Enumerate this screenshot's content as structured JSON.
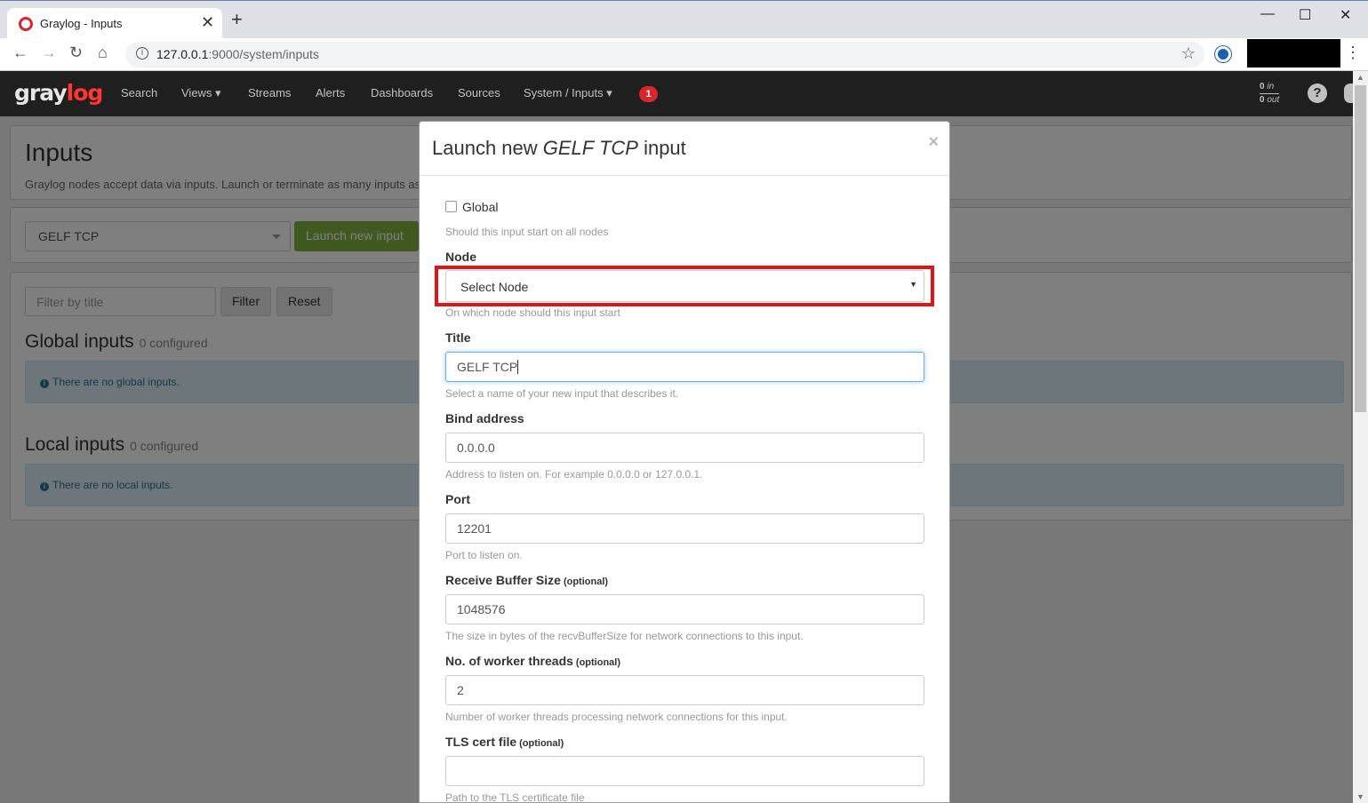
{
  "browser": {
    "tab_title": "Graylog - Inputs",
    "url_host": "127.0.0.1",
    "url_rest": ":9000/system/inputs",
    "new_tab": "+",
    "close": "✕",
    "minimize": "—",
    "maximize": "☐",
    "window_close": "✕"
  },
  "navbar": {
    "logo_gray": "gray",
    "logo_log": "log",
    "items": [
      "Search",
      "Views ▾",
      "Streams",
      "Alerts",
      "Dashboards",
      "Sources",
      "System / Inputs ▾"
    ],
    "badge": "1",
    "throughput_in_count": "0",
    "throughput_in_label": " in",
    "throughput_out_count": "0",
    "throughput_out_label": " out",
    "help": "?"
  },
  "page": {
    "title": "Inputs",
    "description": "Graylog nodes accept data via inputs. Launch or terminate as many inputs as yo",
    "input_type_selected": "GELF TCP",
    "launch_button": "Launch new input",
    "filter_placeholder": "Filter by title",
    "filter_button": "Filter",
    "reset_button": "Reset",
    "global_title": "Global inputs",
    "global_count": "0 configured",
    "global_empty": "There are no global inputs.",
    "local_title": "Local inputs",
    "local_count": "0 configured",
    "local_empty": "There are no local inputs.",
    "info_icon": "i"
  },
  "modal": {
    "title_prefix": "Launch new ",
    "title_type": "GELF TCP",
    "title_suffix": " input",
    "close": "×",
    "global_label": "Global",
    "global_help": "Should this input start on all nodes",
    "node_label": "Node",
    "node_select": "Select Node",
    "node_arrow": "▼",
    "node_help": "On which node should this input start",
    "title_label": "Title",
    "title_value": "GELF TCP",
    "title_help": "Select a name of your new input that describes it.",
    "bind_label": "Bind address",
    "bind_value": "0.0.0.0",
    "bind_help": "Address to listen on. For example 0.0.0.0 or 127.0.0.1.",
    "port_label": "Port",
    "port_value": "12201",
    "port_help": "Port to listen on.",
    "recv_label": "Receive Buffer Size",
    "optional": "(optional)",
    "recv_value": "1048576",
    "recv_help": "The size in bytes of the recvBufferSize for network connections to this input.",
    "workers_label": "No. of worker threads",
    "workers_value": "2",
    "workers_help": "Number of worker threads processing network connections for this input.",
    "tls_label": "TLS cert file",
    "tls_value": "",
    "tls_help": "Path to the TLS certificate file"
  }
}
